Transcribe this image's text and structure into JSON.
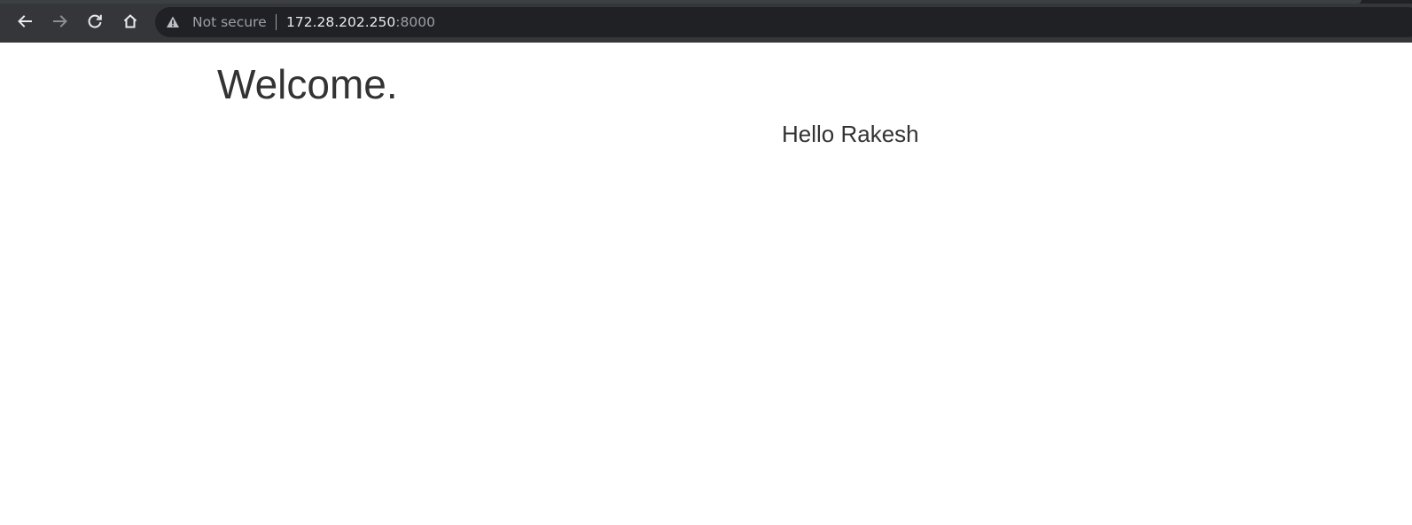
{
  "browser": {
    "toolbar_color": "#35363a",
    "omnibox_color": "#202124",
    "nav": {
      "back_icon": "arrow-left-icon",
      "forward_icon": "arrow-right-icon",
      "reload_icon": "reload-icon",
      "home_icon": "home-icon"
    },
    "address": {
      "security_icon": "warning-triangle-icon",
      "security_label": "Not secure",
      "host": "172.28.202.250",
      "port": ":8000"
    }
  },
  "page": {
    "heading": "Welcome.",
    "greeting": "Hello Rakesh",
    "text_color": "#333333"
  }
}
